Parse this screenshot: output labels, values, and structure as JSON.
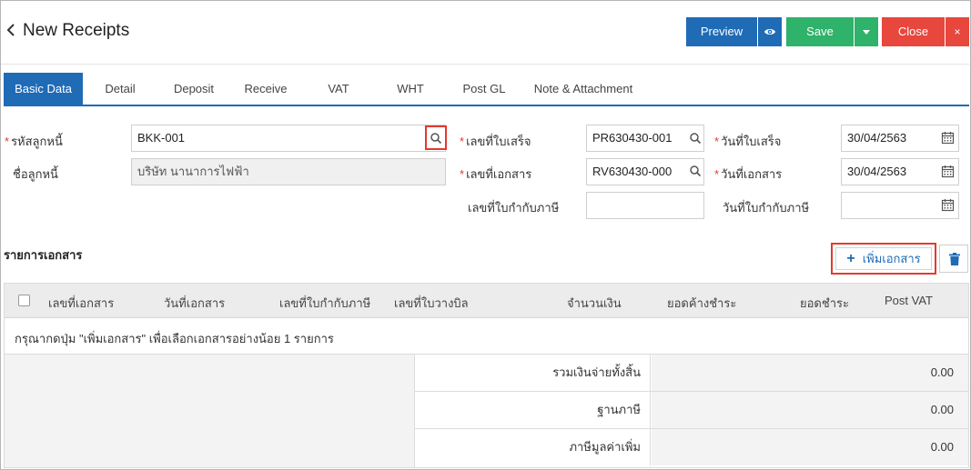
{
  "header": {
    "back_icon": "chevron-left-icon",
    "title": "New Receipts",
    "preview_label": "Preview",
    "save_label": "Save",
    "close_label": "Close",
    "close_x": "×"
  },
  "tabs": [
    {
      "label": "Basic Data",
      "active": true
    },
    {
      "label": "Detail"
    },
    {
      "label": "Deposit"
    },
    {
      "label": "Receive"
    },
    {
      "label": "VAT"
    },
    {
      "label": "WHT"
    },
    {
      "label": "Post GL"
    },
    {
      "label": "Note & Attachment"
    }
  ],
  "form": {
    "debtor_code_label": "รหัสลูกหนี้",
    "debtor_code_value": "BKK-001",
    "debtor_name_label": "ชื่อลูกหนี้",
    "debtor_name_value": "บริษัท นานาการไฟฟ้า",
    "receipt_no_label": "เลขที่ใบเสร็จ",
    "receipt_no_value": "PR630430-001",
    "doc_no_label": "เลขที่เอกสาร",
    "doc_no_value": "RV630430-000",
    "tax_invoice_no_label": "เลขที่ใบกำกับภาษี",
    "tax_invoice_no_value": "",
    "receipt_date_label": "วันที่ใบเสร็จ",
    "receipt_date_value": "30/04/2563",
    "doc_date_label": "วันที่เอกสาร",
    "doc_date_value": "30/04/2563",
    "tax_invoice_date_label": "วันที่ใบกำกับภาษี",
    "tax_invoice_date_value": ""
  },
  "documents": {
    "section_title": "รายการเอกสาร",
    "add_button_label": "เพิ่มเอกสาร",
    "add_icon": "plus-icon",
    "delete_icon": "trash-icon",
    "columns": [
      "เลขที่เอกสาร",
      "วันที่เอกสาร",
      "เลขที่ใบกำกับภาษี",
      "เลขที่ใบวางบิล",
      "จำนวนเงิน",
      "ยอดค้างชำระ",
      "ยอดชำระ",
      "Post VAT"
    ],
    "empty_message": "กรุณากดปุ่ม \"เพิ่มเอกสาร\" เพื่อเลือกเอกสารอย่างน้อย 1 รายการ"
  },
  "summary": [
    {
      "label": "รวมเงินจ่ายทั้งสิ้น",
      "value": "0.00"
    },
    {
      "label": "ฐานภาษี",
      "value": "0.00"
    },
    {
      "label": "ภาษีมูลค่าเพิ่ม",
      "value": "0.00"
    }
  ],
  "colors": {
    "primary": "#1f6bb6",
    "save": "#2fb26a",
    "close": "#e8473d",
    "highlight": "#e23a2e"
  }
}
